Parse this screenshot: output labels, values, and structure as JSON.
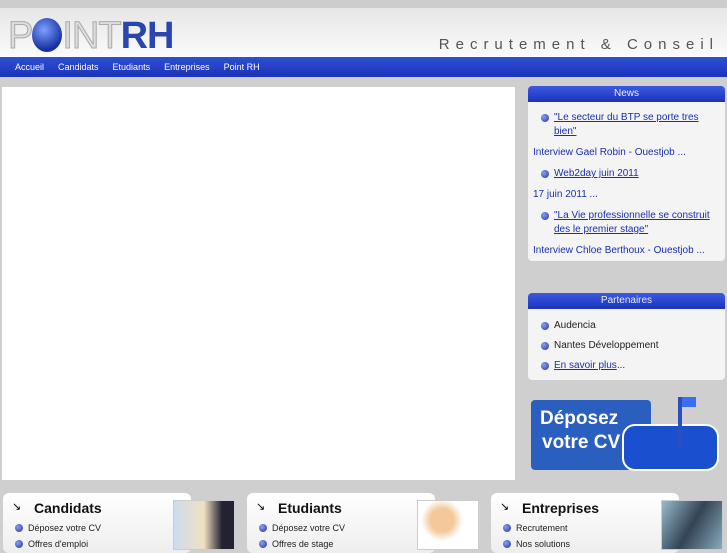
{
  "header": {
    "logo_point": "P",
    "logo_int": "INT",
    "logo_rh": "RH",
    "tagline": "Recrutement & Conseil"
  },
  "nav": [
    "Accueil",
    "Candidats",
    "Etudiants",
    "Entreprises",
    "Point RH"
  ],
  "news": {
    "title": "News",
    "items": [
      {
        "link": "\"Le secteur du BTP se porte tres bien\"",
        "sub": "Interview Gael Robin - Ouestjob ..."
      },
      {
        "link": "Web2day juin 2011",
        "sub": "17 juin 2011 ..."
      },
      {
        "link": "\"La Vie professionnelle se construit des le premier stage\"",
        "sub": "Interview Chloe Berthoux - Ouestjob ..."
      }
    ]
  },
  "partners": {
    "title": "Partenaires",
    "items": [
      "Audencia",
      "Nantes Développement"
    ],
    "more_link": "En savoir plus",
    "more_suffix": " ..."
  },
  "cv_banner": {
    "line1": "Déposez",
    "line2": "votre CV"
  },
  "cards": [
    {
      "title": "Candidats",
      "items": [
        "Déposez votre CV",
        "Offres d'emploi"
      ]
    },
    {
      "title": "Etudiants",
      "items": [
        "Déposez votre CV",
        "Offres de stage"
      ]
    },
    {
      "title": "Entreprises",
      "items": [
        "Recrutement",
        "Nos solutions"
      ]
    }
  ]
}
